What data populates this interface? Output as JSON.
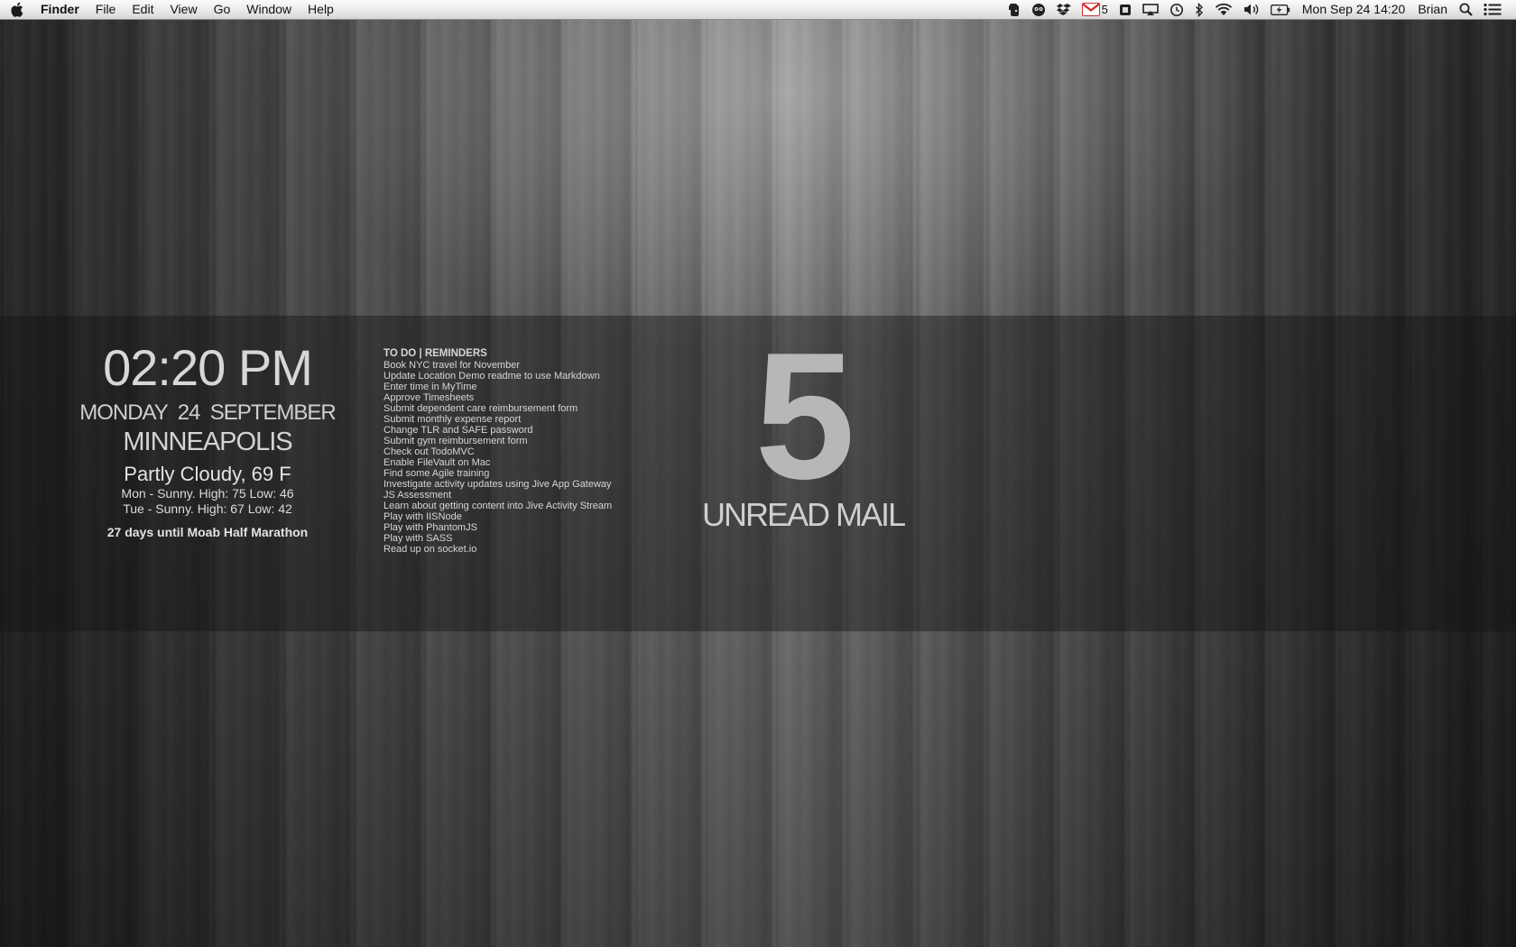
{
  "menubar": {
    "app": "Finder",
    "menus": [
      "File",
      "Edit",
      "View",
      "Go",
      "Window",
      "Help"
    ],
    "gmail_count": "5",
    "clock": "Mon Sep 24  14:20",
    "user": "Brian"
  },
  "clock_widget": {
    "time": "02:20 PM",
    "date": "MONDAY  24  SEPTEMBER",
    "city": "MINNEAPOLIS",
    "current": "Partly Cloudy, 69 F",
    "forecast": [
      "Mon - Sunny. High: 75 Low: 46",
      "Tue - Sunny. High: 67 Low: 42"
    ],
    "countdown": "27 days until Moab Half Marathon"
  },
  "todo": {
    "title": "TO DO | REMINDERS",
    "items": [
      "Book NYC travel for November",
      "Update Location Demo readme to use Markdown",
      "Enter time in MyTime",
      "Approve Timesheets",
      "Submit dependent care reimbursement form",
      "Submit monthly expense report",
      "Change TLR and SAFE password",
      "Submit gym reimbursement form",
      "Check out TodoMVC",
      "Enable FileVault on Mac",
      "Find some Agile training",
      "Investigate activity updates using Jive App Gateway",
      "JS Assessment",
      "Learn about getting content into Jive Activity Stream",
      "Play with IISNode",
      "Play with PhantomJS",
      "Play with SASS",
      "Read up on socket.io"
    ]
  },
  "mail": {
    "count": "5",
    "label": "UNREAD MAIL"
  }
}
